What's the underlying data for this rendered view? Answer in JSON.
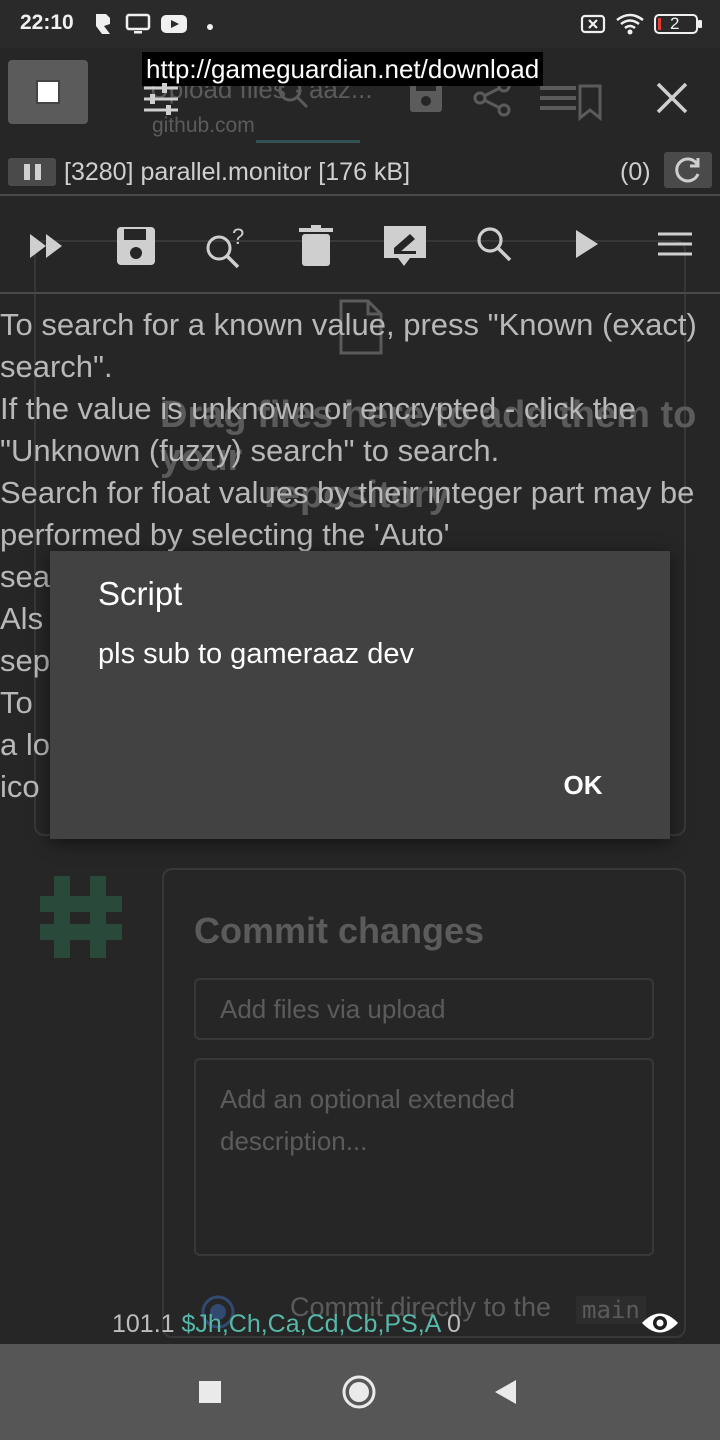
{
  "status_bar": {
    "time": "22:10",
    "battery_level": "2"
  },
  "overlay": {
    "url_label": "http://gameguardian.net/download"
  },
  "background_page": {
    "tab_title": "Upload files · aaz...",
    "tab_domain": "github.com",
    "drop_text": "Drag files here to add them to your",
    "drop_text_2": "repository",
    "commit_title": "Commit changes",
    "commit_summary_placeholder": "Add files via upload",
    "commit_desc_placeholder": "Add an optional extended description...",
    "commit_option": "Commit directly to the",
    "branch": "main"
  },
  "process": {
    "label": "[3280] parallel.monitor [176 kB]",
    "count": "(0)"
  },
  "help_text": "To search for a known value, press \"Known (exact) search\".\nIf the value is unknown or encrypted - click the \"Unknown (fuzzy) search\" to search.\nSearch for float values by their integer part may be performed by selecting the 'Auto'\nsea                                                                    \nAls                                                                  s a\nsep\nTo                                                                     n\na lo                                                                   n\nico",
  "dialog": {
    "title": "Script",
    "message": "pls sub to gameraaz dev",
    "ok_label": "OK"
  },
  "gg_status": {
    "version": "101.1",
    "dollar": "$",
    "regions": "Jh,Ch,Ca,Cd,Cb,PS,A",
    "results": "0"
  }
}
